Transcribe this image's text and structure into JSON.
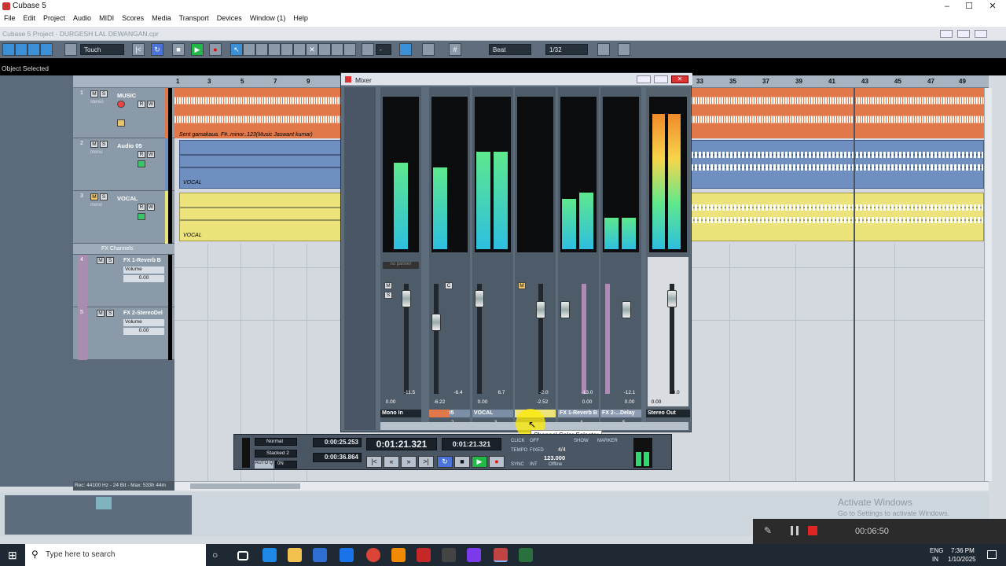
{
  "window": {
    "title": "Cubase 5",
    "minimize": "–",
    "maximize": "☐",
    "close": "✕"
  },
  "menu": [
    "File",
    "Edit",
    "Project",
    "Audio",
    "MIDI",
    "Scores",
    "Media",
    "Transport",
    "Devices",
    "Window (1)",
    "Help"
  ],
  "project": {
    "title": "Cubase 5 Project - DURGESH LAL DEWANGAN.cpr"
  },
  "toolbar": {
    "automation_mode": "Touch",
    "snap_type": "Beat",
    "quantize": "1/32"
  },
  "status": {
    "text": "Object Selected",
    "rec_info": "Rec: 44100 Hz - 24 Bit - Max: 533h 44m"
  },
  "ruler": {
    "marks": [
      "1",
      "3",
      "5",
      "7",
      "9",
      "33",
      "35",
      "37",
      "39",
      "41",
      "43",
      "45",
      "47",
      "49"
    ]
  },
  "tracks": [
    {
      "num": "1",
      "name": "MUSIC",
      "sub": "stereo",
      "color": "#e0784a",
      "event_label": "Sent gamakaua. F#..minor..123(Music Jaswant kumar)"
    },
    {
      "num": "2",
      "name": "Audio 05",
      "sub": "mono",
      "color": "#6f8fc1",
      "event_label": "VOCAL"
    },
    {
      "num": "3",
      "name": "VOCAL",
      "sub": "mono",
      "color": "#ece47a",
      "event_label": "VOCAL"
    }
  ],
  "fx": {
    "folder": "FX Channels",
    "channels": [
      {
        "num": "4",
        "name": "FX 1-Reverb B",
        "param": "Volume",
        "value": "0.00"
      },
      {
        "num": "5",
        "name": "FX 2-StereoDel",
        "param": "Volume",
        "value": "0.00"
      }
    ]
  },
  "mixer": {
    "title": "Mixer",
    "channels": [
      {
        "name": "Mono In",
        "type": "mono",
        "peak": "-11.5",
        "vol": "0.00",
        "level": 0.62,
        "idx": ""
      },
      {
        "name": "Audio 05",
        "type": "stereo",
        "peak": "-6.4",
        "vol": "-6.22",
        "level": 0.56,
        "idx": "2"
      },
      {
        "name": "VOCAL",
        "type": "mono",
        "peak": "6.7",
        "vol": "0.00",
        "level": 0.7,
        "idx": "3"
      },
      {
        "name": "",
        "type": "mono",
        "peak": "-2.0",
        "vol": "-2.52",
        "level": 0.0,
        "idx": ""
      },
      {
        "name": "FX 1-Reverb B",
        "type": "stereo",
        "peak": "-13.0",
        "vol": "0.00",
        "level": 0.42,
        "idx": "4"
      },
      {
        "name": "FX 2-...Delay",
        "type": "stereo",
        "peak": "-12.1",
        "vol": "0.00",
        "level": 0.24,
        "idx": "5"
      }
    ],
    "master": {
      "name": "Stereo Out",
      "peak": "-0.0",
      "vol": "0.00",
      "level": 0.9
    },
    "labels": {
      "no_panner": "no panner"
    }
  },
  "tooltip": "Channel Color Selector",
  "transport": {
    "mode": "Normal",
    "cycle_mode": "Stacked 2",
    "auto_q": "AUTO Q",
    "auto_state": "0N",
    "left_locator": "0:00:25.253",
    "right_locator": "0:00:36.864",
    "position": "0:01:21.321",
    "position_small": "0:01:21.321",
    "click": "CLICK",
    "click_state": "OFF",
    "tempo_label": "TEMPO",
    "tempo_mode": "FIXED",
    "signature": "4/4",
    "tempo": "123.000",
    "sync": "SYNC",
    "sync_source": "INT",
    "sync_state": "Offline",
    "show": "SHOW",
    "marker": "MARKER"
  },
  "activation": {
    "title": "Activate Windows",
    "sub": "Go to Settings to activate Windows."
  },
  "recorder": {
    "elapsed": "00:06:50"
  },
  "taskbar": {
    "search_placeholder": "Type here to search",
    "lang": "ENG",
    "region": "IN",
    "time": "7:36 PM",
    "date": "1/10/2025"
  }
}
